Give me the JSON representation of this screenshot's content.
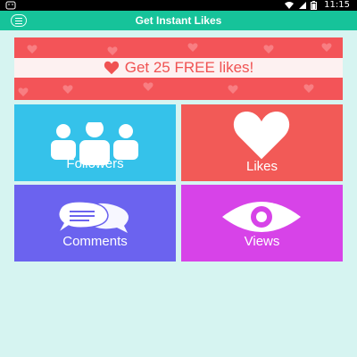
{
  "status_bar": {
    "time": "11:15",
    "icons": [
      "android-icon",
      "wifi-icon",
      "signal-icon",
      "battery-icon"
    ]
  },
  "app_bar": {
    "title": "Get Instant Likes",
    "menu_icon": "menu-icon"
  },
  "banner": {
    "text": "Get 25 FREE likes!",
    "icon": "heart-icon",
    "color": "#f35458"
  },
  "tiles": [
    {
      "label": "Followers",
      "icon": "group-icon",
      "color": "#35c2ea"
    },
    {
      "label": "Likes",
      "icon": "heart-icon",
      "color": "#f25a57"
    },
    {
      "label": "Comments",
      "icon": "chat-bubbles-icon",
      "color": "#6b63ef"
    },
    {
      "label": "Views",
      "icon": "eye-icon",
      "color": "#d743e8"
    }
  ]
}
